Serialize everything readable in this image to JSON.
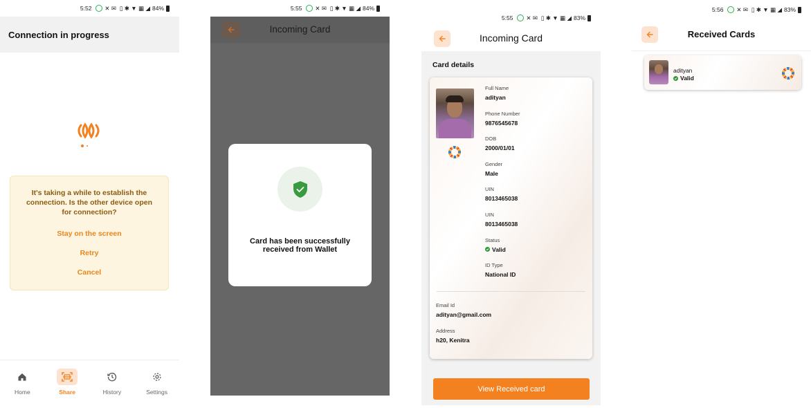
{
  "status_bars": [
    {
      "time": "5:52",
      "battery": "84%"
    },
    {
      "time": "5:55",
      "battery": "84%"
    },
    {
      "time": "5:55",
      "battery": "83%"
    },
    {
      "time": "5:56",
      "battery": "83%"
    }
  ],
  "connecting_screen": {
    "title": "Connection in progress",
    "warning": {
      "message": "It's taking a while to establish the connection. Is the other device open for connection?",
      "actions": [
        "Stay on the screen",
        "Retry",
        "Cancel"
      ]
    },
    "bottom_nav": [
      {
        "label": "Home",
        "icon": "home-icon",
        "active": false
      },
      {
        "label": "Share",
        "icon": "scan-icon",
        "active": true
      },
      {
        "label": "History",
        "icon": "history-icon",
        "active": false
      },
      {
        "label": "Settings",
        "icon": "gear-icon",
        "active": false
      }
    ]
  },
  "success_screen": {
    "title": "Incoming Card",
    "modal_message": "Card has been successfully received from Wallet",
    "modal_icon": "shield-check-icon"
  },
  "incoming_card_screen": {
    "title": "Incoming Card",
    "section_label": "Card details",
    "fields": [
      {
        "label": "Full Name",
        "value": "adityan"
      },
      {
        "label": "Phone Number",
        "value": "9876545678"
      },
      {
        "label": "DOB",
        "value": "2000/01/01"
      },
      {
        "label": "Gender",
        "value": "Male"
      },
      {
        "label": "UIN",
        "value": "8013465038"
      },
      {
        "label": "UIN",
        "value": "8013465038"
      },
      {
        "label": "Status",
        "value": "Valid"
      },
      {
        "label": "ID Type",
        "value": "National ID"
      }
    ],
    "email": {
      "label": "Email Id",
      "value": "adityan@gmail.com"
    },
    "address": {
      "label": "Address",
      "value": "h20, Kenitra"
    },
    "button": "View Received card"
  },
  "received_cards_screen": {
    "title": "Received Cards",
    "cards": [
      {
        "name": "adityan",
        "status": "Valid"
      }
    ]
  },
  "colors": {
    "accent": "#f4811f",
    "valid": "#2f9a3a",
    "warning_bg": "#fdf5df",
    "warning_text": "#8a5c14"
  }
}
